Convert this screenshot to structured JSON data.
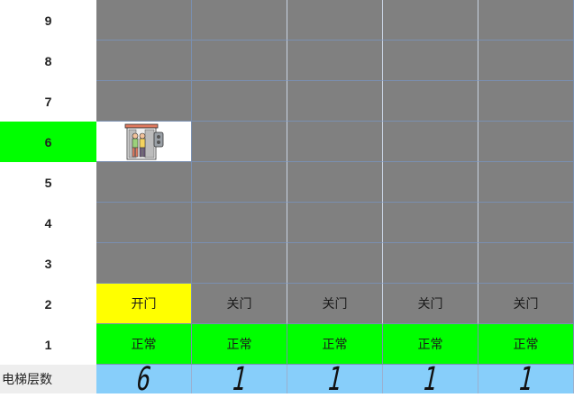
{
  "floors": [
    {
      "label": "9",
      "active": false
    },
    {
      "label": "8",
      "active": false
    },
    {
      "label": "7",
      "active": false
    },
    {
      "label": "6",
      "active": true
    },
    {
      "label": "5",
      "active": false
    },
    {
      "label": "4",
      "active": false
    },
    {
      "label": "3",
      "active": false
    },
    {
      "label": "2",
      "active": false
    },
    {
      "label": "1",
      "active": false
    }
  ],
  "elevators": [
    {
      "car_floor": "6",
      "door_status": "开门",
      "run_status": "正常",
      "floor_display": "6"
    },
    {
      "car_floor": "1",
      "door_status": "关门",
      "run_status": "正常",
      "floor_display": "1"
    },
    {
      "car_floor": "1",
      "door_status": "关门",
      "run_status": "正常",
      "floor_display": "1"
    },
    {
      "car_floor": "1",
      "door_status": "关门",
      "run_status": "正常",
      "floor_display": "1"
    },
    {
      "car_floor": "1",
      "door_status": "关门",
      "run_status": "正常",
      "floor_display": "1"
    }
  ],
  "footer": {
    "label": "电梯层数"
  },
  "icons": {
    "car": "elevator-car-icon"
  },
  "colors": {
    "shaft": "#808080",
    "active_floor": "#00ff00",
    "door_open": "#ffff00",
    "normal_status": "#00ff00",
    "counter_bg": "#87cefa"
  }
}
